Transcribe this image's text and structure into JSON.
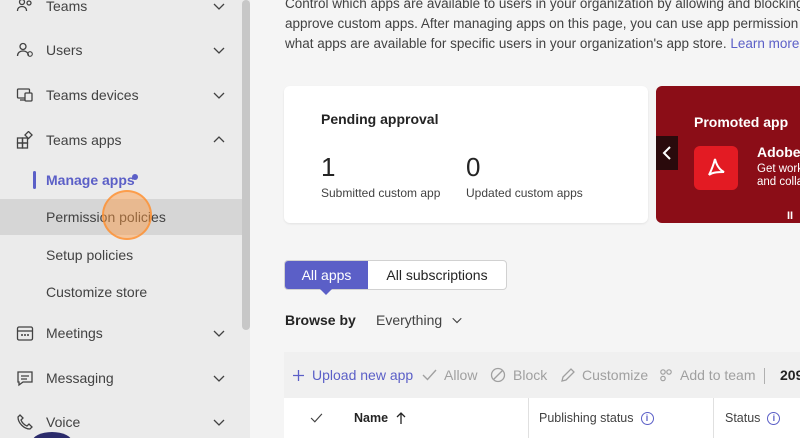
{
  "sidebar": {
    "items": [
      {
        "label": "Teams",
        "icon": "teams-icon",
        "expanded": false
      },
      {
        "label": "Users",
        "icon": "users-icon",
        "expanded": false
      },
      {
        "label": "Teams devices",
        "icon": "devices-icon",
        "expanded": false
      },
      {
        "label": "Teams apps",
        "icon": "apps-icon",
        "expanded": true
      },
      {
        "label": "Meetings",
        "icon": "meetings-icon",
        "expanded": false
      },
      {
        "label": "Messaging",
        "icon": "messaging-icon",
        "expanded": false
      },
      {
        "label": "Voice",
        "icon": "voice-icon",
        "expanded": false
      }
    ],
    "subitems": [
      {
        "label": "Manage apps",
        "state": "active"
      },
      {
        "label": "Permission policies",
        "state": "hovered"
      },
      {
        "label": "Setup policies",
        "state": "normal"
      },
      {
        "label": "Customize store",
        "state": "normal"
      }
    ]
  },
  "intro": {
    "line1": "Control which apps are available to users in your organization by allowing and blocking apps",
    "line2": "approve custom apps. After managing apps on this page, you can use app permission and",
    "line3": "what apps are available for specific users in your organization's app store.",
    "link": "Learn more"
  },
  "pending": {
    "title": "Pending approval",
    "submitted_count": "1",
    "submitted_label": "Submitted custom app",
    "updated_count": "0",
    "updated_label": "Updated custom apps"
  },
  "promoted": {
    "title": "Promoted app",
    "app_name": "Adobe",
    "desc_line1": "Get work",
    "desc_line2": "and colla",
    "pause_label": "II"
  },
  "tabs": [
    {
      "label": "All apps",
      "selected": true
    },
    {
      "label": "All subscriptions",
      "selected": false
    }
  ],
  "browse": {
    "label": "Browse by",
    "value": "Everything"
  },
  "toolbar": {
    "upload": "Upload new app",
    "allow": "Allow",
    "block": "Block",
    "customize": "Customize",
    "add_to_team": "Add to team",
    "count": "209"
  },
  "table": {
    "headers": [
      "Name",
      "Publishing status",
      "Status"
    ]
  },
  "colors": {
    "accent": "#5b5fc7",
    "sidebar_bg": "#ebebeb",
    "promo_bg": "#8b0d17"
  }
}
